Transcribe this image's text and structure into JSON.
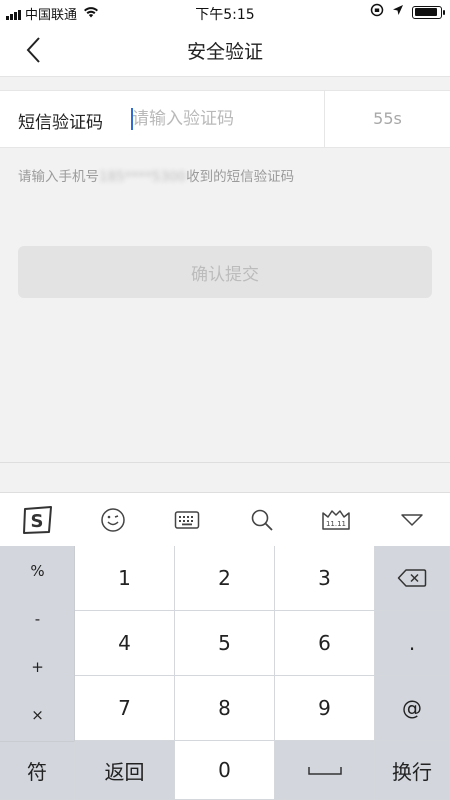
{
  "status_bar": {
    "carrier": "中国联通",
    "time": "下午5:15",
    "battery_level": 0.9
  },
  "nav": {
    "title": "安全验证",
    "back_icon": "chevron-left-icon"
  },
  "form": {
    "label": "短信验证码",
    "placeholder": "请输入验证码",
    "countdown": "55s"
  },
  "hint": {
    "prefix": "请输入手机号",
    "masked_phone": "185****5300",
    "suffix": "收到的短信验证码"
  },
  "submit_label": "确认提交",
  "keyboard": {
    "toolbar_icons": [
      "sogou-logo-icon",
      "emoji-icon",
      "keyboard-icon",
      "search-icon",
      "double11-icon",
      "collapse-keyboard-icon"
    ],
    "symbols": [
      "%",
      "-",
      "+",
      "×"
    ],
    "digits": [
      "1",
      "2",
      "3",
      "4",
      "5",
      "6",
      "7",
      "8",
      "9"
    ],
    "right_keys": [
      ".",
      "@"
    ],
    "bottom": {
      "symbol_key": "符",
      "back_key": "返回",
      "zero": "0",
      "enter_key": "换行"
    }
  },
  "colors": {
    "accent_caret": "#2f6bd6",
    "disabled_button": "#e3e3e3",
    "keyboard_gray": "#d3d7dd"
  }
}
